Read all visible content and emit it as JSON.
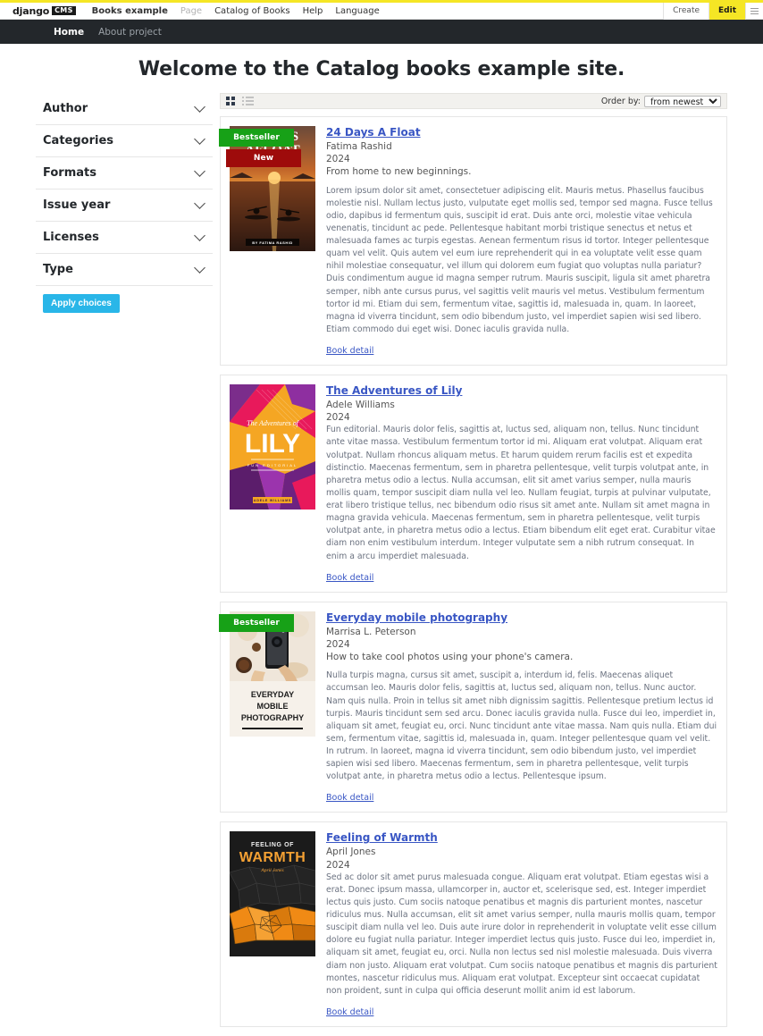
{
  "cms_toolbar": {
    "logo_text": "django",
    "logo_badge": "CMS",
    "menu": [
      {
        "label": "Books example",
        "state": "strong"
      },
      {
        "label": "Page",
        "state": "dim"
      },
      {
        "label": "Catalog of Books",
        "state": "normal"
      },
      {
        "label": "Help",
        "state": "normal"
      },
      {
        "label": "Language",
        "state": "normal"
      }
    ],
    "create_label": "Create",
    "edit_label": "Edit",
    "accent_color": "#f5e625"
  },
  "site_nav": {
    "items": [
      {
        "label": "Home",
        "active": true
      },
      {
        "label": "About project",
        "active": false
      }
    ]
  },
  "page": {
    "title": "Welcome to the Catalog books example site."
  },
  "sidebar": {
    "filters": [
      {
        "label": "Author"
      },
      {
        "label": "Categories"
      },
      {
        "label": "Formats"
      },
      {
        "label": "Issue year"
      },
      {
        "label": "Licenses"
      },
      {
        "label": "Type"
      }
    ],
    "apply_label": "Apply choices",
    "apply_color": "#29b6e8"
  },
  "toolbar": {
    "order_label": "Order by:",
    "order_value": "from newest",
    "order_options": [
      "from newest"
    ]
  },
  "books": [
    {
      "title": "24 Days A Float",
      "author": "Fatima Rashid",
      "year": "2024",
      "subtitle": "From home to new beginnings.",
      "badges": [
        {
          "label": "Bestseller",
          "color": "#17a117"
        },
        {
          "label": "New",
          "color": "#9e0b0b"
        }
      ],
      "cover": {
        "style": "sunset-kayak",
        "title_line1": "24 DAYS",
        "title_line2": "AFLOAT",
        "author_line": "BY FATIMA RASHID"
      },
      "description": "Lorem ipsum dolor sit amet, consectetuer adipiscing elit. Mauris metus. Phasellus faucibus molestie nisl. Nullam lectus justo, vulputate eget mollis sed, tempor sed magna. Fusce tellus odio, dapibus id fermentum quis, suscipit id erat. Duis ante orci, molestie vitae vehicula venenatis, tincidunt ac pede. Pellentesque habitant morbi tristique senectus et netus et malesuada fames ac turpis egestas. Aenean fermentum risus id tortor. Integer pellentesque quam vel velit. Quis autem vel eum iure reprehenderit qui in ea voluptate velit esse quam nihil molestiae consequatur, vel illum qui dolorem eum fugiat quo voluptas nulla pariatur? Duis condimentum augue id magna semper rutrum. Mauris suscipit, ligula sit amet pharetra semper, nibh ante cursus purus, vel sagittis velit mauris vel metus. Vestibulum fermentum tortor id mi. Etiam dui sem, fermentum vitae, sagittis id, malesuada in, quam. In laoreet, magna id viverra tincidunt, sem odio bibendum justo, vel imperdiet sapien wisi sed libero. Etiam commodo dui eget wisi. Donec iaculis gravida nulla.",
      "detail_label": "Book detail"
    },
    {
      "title": "The Adventures of Lily",
      "author": "Adele Williams",
      "year": "2024",
      "subtitle": "",
      "badges": [],
      "cover": {
        "style": "lily-abstract",
        "title_line1": "The Adventures of",
        "title_line2": "LILY",
        "tagline": "FUN EDITORIAL",
        "author_line": "ADELE WILLIAMS"
      },
      "description": "Fun editorial. Mauris dolor felis, sagittis at, luctus sed, aliquam non, tellus. Nunc tincidunt ante vitae massa. Vestibulum fermentum tortor id mi. Aliquam erat volutpat. Aliquam erat volutpat. Nullam rhoncus aliquam metus. Et harum quidem rerum facilis est et expedita distinctio. Maecenas fermentum, sem in pharetra pellentesque, velit turpis volutpat ante, in pharetra metus odio a lectus. Nulla accumsan, elit sit amet varius semper, nulla mauris mollis quam, tempor suscipit diam nulla vel leo. Nullam feugiat, turpis at pulvinar vulputate, erat libero tristique tellus, nec bibendum odio risus sit amet ante. Nullam sit amet magna in magna gravida vehicula. Maecenas fermentum, sem in pharetra pellentesque, velit turpis volutpat ante, in pharetra metus odio a lectus. Etiam bibendum elit eget erat. Curabitur vitae diam non enim vestibulum interdum. Integer vulputate sem a nibh rutrum consequat. In enim a arcu imperdiet malesuada.",
      "detail_label": "Book detail"
    },
    {
      "title": "Everyday mobile photography",
      "author": "Marrisa L. Peterson",
      "year": "2024",
      "subtitle": "How to take cool photos using your phone's camera.",
      "badges": [
        {
          "label": "Bestseller",
          "color": "#17a117"
        }
      ],
      "cover": {
        "style": "photo-phone",
        "title_line1": "EVERYDAY",
        "title_line2": "MOBILE",
        "title_line3": "PHOTOGRAPHY"
      },
      "description": "Nulla turpis magna, cursus sit amet, suscipit a, interdum id, felis. Maecenas aliquet accumsan leo. Mauris dolor felis, sagittis at, luctus sed, aliquam non, tellus. Nunc auctor. Nam quis nulla. Proin in tellus sit amet nibh dignissim sagittis. Pellentesque pretium lectus id turpis. Mauris tincidunt sem sed arcu. Donec iaculis gravida nulla. Fusce dui leo, imperdiet in, aliquam sit amet, feugiat eu, orci. Nunc tincidunt ante vitae massa. Nam quis nulla. Etiam dui sem, fermentum vitae, sagittis id, malesuada in, quam. Integer pellentesque quam vel velit. In rutrum. In laoreet, magna id viverra tincidunt, sem odio bibendum justo, vel imperdiet sapien wisi sed libero. Maecenas fermentum, sem in pharetra pellentesque, velit turpis volutpat ante, in pharetra metus odio a lectus. Pellentesque ipsum.",
      "detail_label": "Book detail"
    },
    {
      "title": "Feeling of Warmth",
      "author": "April Jones",
      "year": "2024",
      "subtitle": "",
      "badges": [],
      "cover": {
        "style": "warmth-geometric",
        "title_line1": "FEELING OF",
        "title_line2": "WARMTH",
        "author_line": "April Jones"
      },
      "description": "Sed ac dolor sit amet purus malesuada congue. Aliquam erat volutpat. Etiam egestas wisi a erat. Donec ipsum massa, ullamcorper in, auctor et, scelerisque sed, est. Integer imperdiet lectus quis justo. Cum sociis natoque penatibus et magnis dis parturient montes, nascetur ridiculus mus. Nulla accumsan, elit sit amet varius semper, nulla mauris mollis quam, tempor suscipit diam nulla vel leo. Duis aute irure dolor in reprehenderit in voluptate velit esse cillum dolore eu fugiat nulla pariatur. Integer imperdiet lectus quis justo. Fusce dui leo, imperdiet in, aliquam sit amet, feugiat eu, orci. Nulla non lectus sed nisl molestie malesuada. Duis viverra diam non justo. Aliquam erat volutpat. Cum sociis natoque penatibus et magnis dis parturient montes, nascetur ridiculus mus. Aliquam erat volutpat. Excepteur sint occaecat cupidatat non proident, sunt in culpa qui officia deserunt mollit anim id est laborum.",
      "detail_label": "Book detail"
    }
  ]
}
